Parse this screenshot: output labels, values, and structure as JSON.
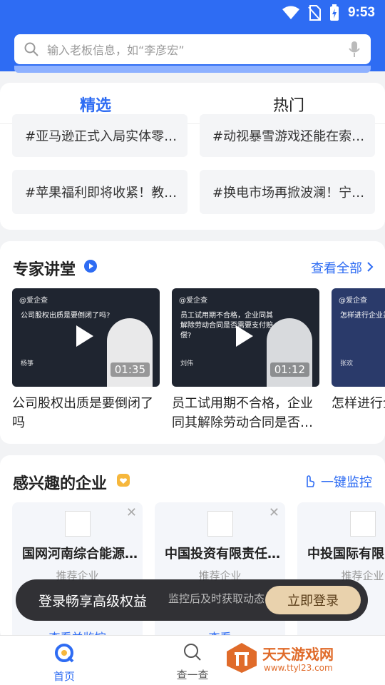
{
  "status": {
    "time": "9:53"
  },
  "search": {
    "placeholder": "输入老板信息，如“李彦宏”"
  },
  "tabs": [
    {
      "label": "精选"
    },
    {
      "label": "热门"
    }
  ],
  "topics": [
    "#亚马逊正式入局实体零…",
    "#动视暴雪游戏还能在索…",
    "#苹果福利即将收紧！教…",
    "#换电市场再掀波澜！宁…"
  ],
  "experts": {
    "title": "专家讲堂",
    "link": "查看全部",
    "videos": [
      {
        "logo": "@爱企查",
        "question": "公司股权出质是要倒闭了吗?",
        "speaker": "杨箏",
        "duration": "01:35",
        "title": "公司股权出质是要倒闭了吗"
      },
      {
        "logo": "@爱企查",
        "question": "员工试用期不合格，企业同其解除劳动合同是否需要支付赔偿?",
        "speaker": "刘伟",
        "duration": "01:12",
        "title": "员工试用期不合格，企业同其解除劳动合同是否…"
      },
      {
        "logo": "@爱企查",
        "question": "怎样进行企业并购",
        "speaker": "张欢",
        "duration": "",
        "title": "怎样进行企业并购"
      }
    ]
  },
  "companies": {
    "title": "感兴趣的企业",
    "link": "一键监控",
    "items": [
      {
        "name": "国网河南综合能源…",
        "tag": "推荐企业",
        "action": "查看并监控"
      },
      {
        "name": "中国投资有限责任…",
        "tag": "推荐企业",
        "action": "查看"
      },
      {
        "name": "中投国际有限",
        "tag": "推荐企业",
        "action": ""
      }
    ]
  },
  "toast": {
    "text": "登录畅享高级权益",
    "sub": "监控后及时获取动态",
    "button": "立即登录"
  },
  "nav": [
    {
      "label": "首页"
    },
    {
      "label": "查一查"
    }
  ],
  "watermark": {
    "name": "天天游戏网",
    "url": "www.ttyl23.com"
  },
  "colors": {
    "primary": "#2e6cf3",
    "toast_button": "#e9d2ad"
  }
}
